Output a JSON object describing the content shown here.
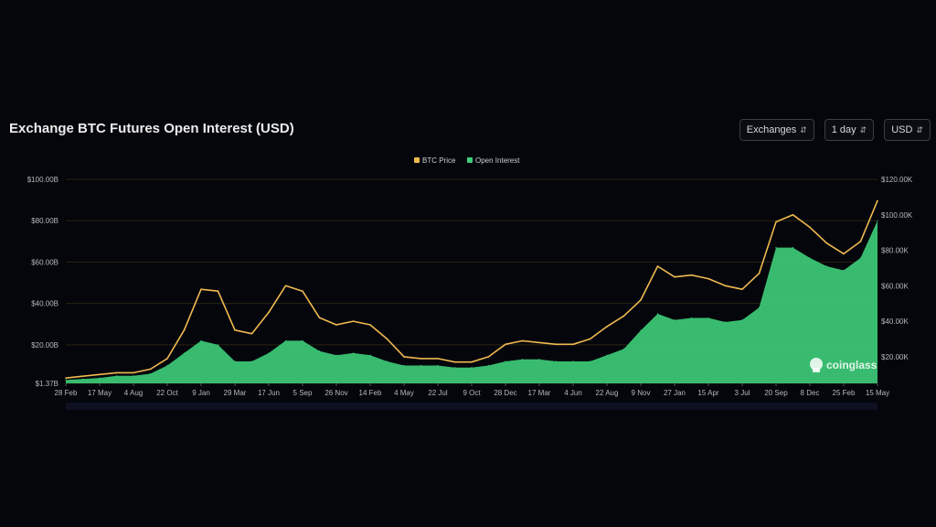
{
  "header": {
    "title": "Exchange BTC Futures Open Interest (USD)"
  },
  "controls": [
    {
      "label": "Exchanges",
      "icon": "up-down-chevron-icon"
    },
    {
      "label": "1 day",
      "icon": "up-down-chevron-icon"
    },
    {
      "label": "USD",
      "icon": "up-down-chevron-icon"
    }
  ],
  "watermark": {
    "text": "coinglass",
    "icon": "coinglass-logo-icon"
  },
  "colors": {
    "price": "#f0b94f",
    "oi": "#3ecf7a",
    "background": "#04060c",
    "grid": "#2a2310"
  },
  "chart_data": {
    "type": "area",
    "legend": {
      "position": "top-center",
      "entries": [
        "BTC Price",
        "Open Interest"
      ]
    },
    "grid": true,
    "left_axis": {
      "ticks": [
        "$1.37B",
        "$20.00B",
        "$40.00B",
        "$60.00B",
        "$80.00B",
        "$100.00B"
      ],
      "values": [
        1.37,
        20,
        40,
        60,
        80,
        100
      ],
      "range": [
        1.37,
        100
      ]
    },
    "right_axis": {
      "ticks": [
        "$20.00K",
        "$40.00K",
        "$60.00K",
        "$80.00K",
        "$100.00K",
        "$120.00K"
      ],
      "values": [
        20,
        40,
        60,
        80,
        100,
        120
      ],
      "range": [
        5,
        120
      ]
    },
    "x_ticks": [
      "28 Feb",
      "17 May",
      "4 Aug",
      "22 Oct",
      "9 Jan",
      "29 Mar",
      "17 Jun",
      "5 Sep",
      "26 Nov",
      "14 Feb",
      "4 May",
      "22 Jul",
      "9 Oct",
      "28 Dec",
      "17 Mar",
      "4 Jun",
      "22 Aug",
      "9 Nov",
      "27 Jan",
      "15 Apr",
      "3 Jul",
      "20 Sep",
      "8 Dec",
      "25 Feb",
      "15 May"
    ],
    "series": [
      {
        "name": "BTC Price",
        "axis": "right",
        "unit": "K USD",
        "values": [
          8,
          9,
          10,
          11,
          11,
          13,
          19,
          35,
          58,
          57,
          35,
          33,
          45,
          60,
          57,
          42,
          38,
          40,
          38,
          30,
          20,
          19,
          19,
          17,
          17,
          20,
          27,
          29,
          28,
          27,
          27,
          30,
          37,
          43,
          52,
          71,
          65,
          66,
          64,
          60,
          58,
          67,
          96,
          100,
          93,
          84,
          78,
          85,
          108
        ]
      },
      {
        "name": "Open Interest",
        "axis": "left",
        "unit": "B USD",
        "values": [
          3,
          3.5,
          4,
          5,
          5,
          6,
          10,
          16,
          22,
          20,
          12,
          12,
          16,
          22,
          22,
          17,
          15,
          16,
          15,
          12,
          10,
          10,
          10,
          9,
          9,
          10,
          12,
          13,
          13,
          12,
          12,
          12,
          15,
          18,
          27,
          35,
          32,
          33,
          33,
          31,
          32,
          38,
          67,
          67,
          62,
          58,
          56,
          62,
          80
        ]
      }
    ]
  }
}
